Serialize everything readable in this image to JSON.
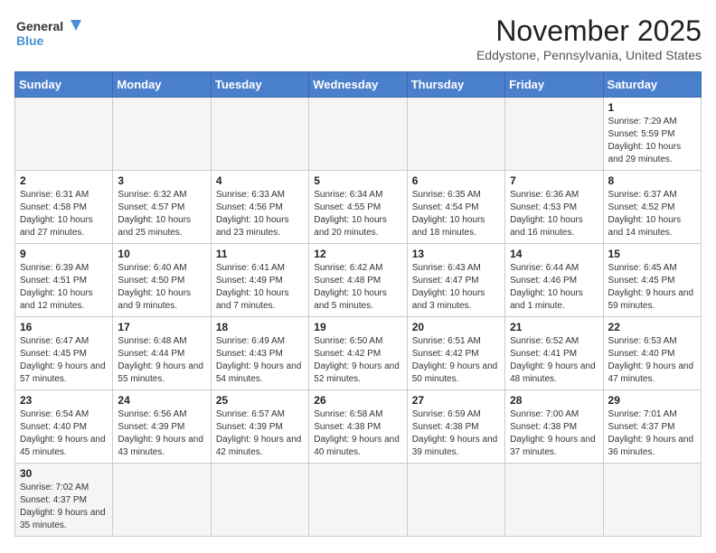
{
  "header": {
    "logo_general": "General",
    "logo_blue": "Blue",
    "month_title": "November 2025",
    "location": "Eddystone, Pennsylvania, United States"
  },
  "weekdays": [
    "Sunday",
    "Monday",
    "Tuesday",
    "Wednesday",
    "Thursday",
    "Friday",
    "Saturday"
  ],
  "weeks": [
    [
      {
        "day": "",
        "info": ""
      },
      {
        "day": "",
        "info": ""
      },
      {
        "day": "",
        "info": ""
      },
      {
        "day": "",
        "info": ""
      },
      {
        "day": "",
        "info": ""
      },
      {
        "day": "",
        "info": ""
      },
      {
        "day": "1",
        "info": "Sunrise: 7:29 AM\nSunset: 5:59 PM\nDaylight: 10 hours and 29 minutes."
      }
    ],
    [
      {
        "day": "2",
        "info": "Sunrise: 6:31 AM\nSunset: 4:58 PM\nDaylight: 10 hours and 27 minutes."
      },
      {
        "day": "3",
        "info": "Sunrise: 6:32 AM\nSunset: 4:57 PM\nDaylight: 10 hours and 25 minutes."
      },
      {
        "day": "4",
        "info": "Sunrise: 6:33 AM\nSunset: 4:56 PM\nDaylight: 10 hours and 23 minutes."
      },
      {
        "day": "5",
        "info": "Sunrise: 6:34 AM\nSunset: 4:55 PM\nDaylight: 10 hours and 20 minutes."
      },
      {
        "day": "6",
        "info": "Sunrise: 6:35 AM\nSunset: 4:54 PM\nDaylight: 10 hours and 18 minutes."
      },
      {
        "day": "7",
        "info": "Sunrise: 6:36 AM\nSunset: 4:53 PM\nDaylight: 10 hours and 16 minutes."
      },
      {
        "day": "8",
        "info": "Sunrise: 6:37 AM\nSunset: 4:52 PM\nDaylight: 10 hours and 14 minutes."
      }
    ],
    [
      {
        "day": "9",
        "info": "Sunrise: 6:39 AM\nSunset: 4:51 PM\nDaylight: 10 hours and 12 minutes."
      },
      {
        "day": "10",
        "info": "Sunrise: 6:40 AM\nSunset: 4:50 PM\nDaylight: 10 hours and 9 minutes."
      },
      {
        "day": "11",
        "info": "Sunrise: 6:41 AM\nSunset: 4:49 PM\nDaylight: 10 hours and 7 minutes."
      },
      {
        "day": "12",
        "info": "Sunrise: 6:42 AM\nSunset: 4:48 PM\nDaylight: 10 hours and 5 minutes."
      },
      {
        "day": "13",
        "info": "Sunrise: 6:43 AM\nSunset: 4:47 PM\nDaylight: 10 hours and 3 minutes."
      },
      {
        "day": "14",
        "info": "Sunrise: 6:44 AM\nSunset: 4:46 PM\nDaylight: 10 hours and 1 minute."
      },
      {
        "day": "15",
        "info": "Sunrise: 6:45 AM\nSunset: 4:45 PM\nDaylight: 9 hours and 59 minutes."
      }
    ],
    [
      {
        "day": "16",
        "info": "Sunrise: 6:47 AM\nSunset: 4:45 PM\nDaylight: 9 hours and 57 minutes."
      },
      {
        "day": "17",
        "info": "Sunrise: 6:48 AM\nSunset: 4:44 PM\nDaylight: 9 hours and 55 minutes."
      },
      {
        "day": "18",
        "info": "Sunrise: 6:49 AM\nSunset: 4:43 PM\nDaylight: 9 hours and 54 minutes."
      },
      {
        "day": "19",
        "info": "Sunrise: 6:50 AM\nSunset: 4:42 PM\nDaylight: 9 hours and 52 minutes."
      },
      {
        "day": "20",
        "info": "Sunrise: 6:51 AM\nSunset: 4:42 PM\nDaylight: 9 hours and 50 minutes."
      },
      {
        "day": "21",
        "info": "Sunrise: 6:52 AM\nSunset: 4:41 PM\nDaylight: 9 hours and 48 minutes."
      },
      {
        "day": "22",
        "info": "Sunrise: 6:53 AM\nSunset: 4:40 PM\nDaylight: 9 hours and 47 minutes."
      }
    ],
    [
      {
        "day": "23",
        "info": "Sunrise: 6:54 AM\nSunset: 4:40 PM\nDaylight: 9 hours and 45 minutes."
      },
      {
        "day": "24",
        "info": "Sunrise: 6:56 AM\nSunset: 4:39 PM\nDaylight: 9 hours and 43 minutes."
      },
      {
        "day": "25",
        "info": "Sunrise: 6:57 AM\nSunset: 4:39 PM\nDaylight: 9 hours and 42 minutes."
      },
      {
        "day": "26",
        "info": "Sunrise: 6:58 AM\nSunset: 4:38 PM\nDaylight: 9 hours and 40 minutes."
      },
      {
        "day": "27",
        "info": "Sunrise: 6:59 AM\nSunset: 4:38 PM\nDaylight: 9 hours and 39 minutes."
      },
      {
        "day": "28",
        "info": "Sunrise: 7:00 AM\nSunset: 4:38 PM\nDaylight: 9 hours and 37 minutes."
      },
      {
        "day": "29",
        "info": "Sunrise: 7:01 AM\nSunset: 4:37 PM\nDaylight: 9 hours and 36 minutes."
      }
    ],
    [
      {
        "day": "30",
        "info": "Sunrise: 7:02 AM\nSunset: 4:37 PM\nDaylight: 9 hours and 35 minutes."
      },
      {
        "day": "",
        "info": ""
      },
      {
        "day": "",
        "info": ""
      },
      {
        "day": "",
        "info": ""
      },
      {
        "day": "",
        "info": ""
      },
      {
        "day": "",
        "info": ""
      },
      {
        "day": "",
        "info": ""
      }
    ]
  ]
}
